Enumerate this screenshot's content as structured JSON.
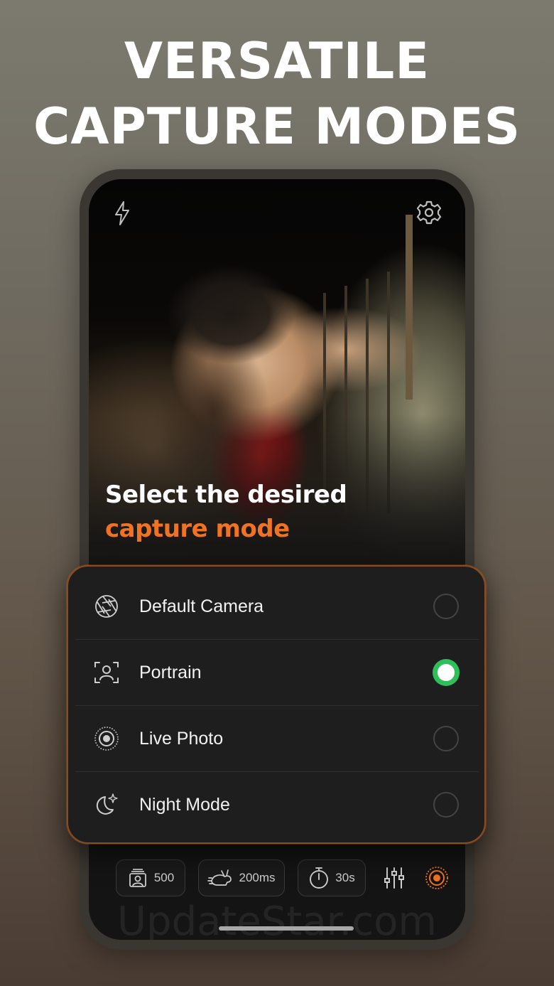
{
  "headline": {
    "line1": "VERSATILE",
    "line2": "CAPTURE MODES"
  },
  "camera": {
    "flash_icon": "flash-icon",
    "settings_icon": "gear-icon",
    "prompt_line1": "Select the desired",
    "prompt_line2": "capture mode",
    "accent_color": "#ef7322"
  },
  "modes": [
    {
      "label": "Default Camera",
      "icon": "aperture-icon",
      "selected": false
    },
    {
      "label": "Portrain",
      "icon": "portrait-frame-icon",
      "selected": true
    },
    {
      "label": "Live Photo",
      "icon": "live-photo-icon",
      "selected": false
    },
    {
      "label": "Night Mode",
      "icon": "moon-stars-icon",
      "selected": false
    }
  ],
  "toolbar": {
    "photos_count": "500",
    "interval": "200ms",
    "timer": "30s",
    "sliders_icon": "sliders-icon",
    "record_icon": "record-icon"
  },
  "watermark": "UpdateStar.com",
  "selected_color": "#2fbf5a"
}
